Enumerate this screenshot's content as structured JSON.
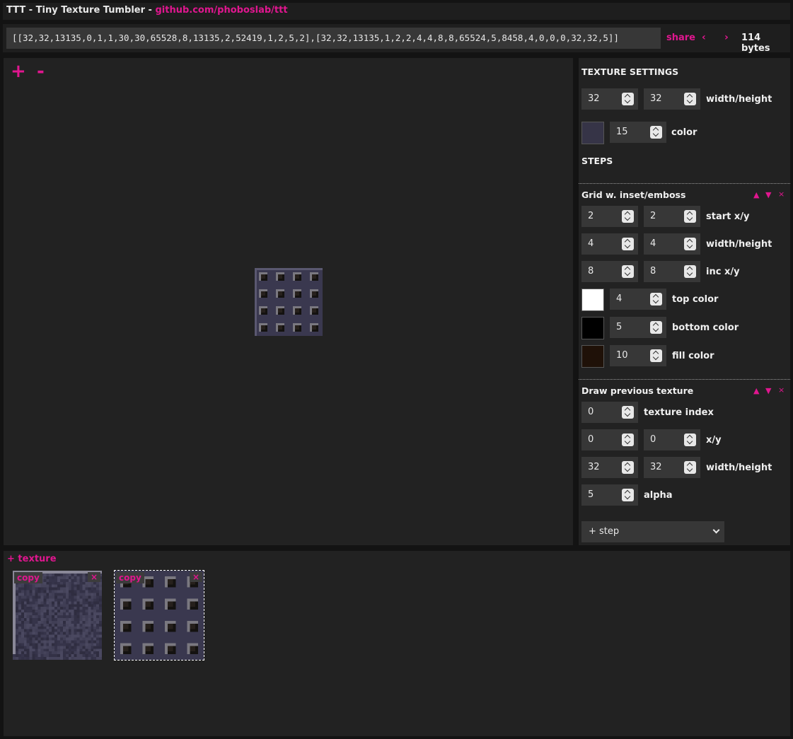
{
  "header": {
    "title": "TTT - Tiny Texture Tumbler - ",
    "link": "github.com/phoboslab/ttt"
  },
  "codebar": {
    "code": "[[32,32,13135,0,1,1,30,30,65528,8,13135,2,52419,1,2,5,2],[32,32,13135,1,2,2,4,4,8,8,65524,5,8458,4,0,0,0,32,32,5]]",
    "share": "share",
    "prev": "‹",
    "next": "›",
    "bytes": "114 bytes"
  },
  "canvas": {
    "zoom_in": "+",
    "zoom_out": "-"
  },
  "panel": {
    "texture_settings": {
      "title": "TEXTURE SETTINGS",
      "width": "32",
      "height": "32",
      "size_label": "width/height",
      "color_value": "15",
      "color_label": "color",
      "color_hex": "#363447"
    },
    "steps_title": "STEPS",
    "grid_step": {
      "title": "Grid w. inset/emboss",
      "start_x": "2",
      "start_y": "2",
      "start_label": "start x/y",
      "width": "4",
      "height": "4",
      "size_label": "width/height",
      "inc_x": "8",
      "inc_y": "8",
      "inc_label": "inc x/y",
      "top_color": "4",
      "top_label": "top color",
      "top_hex": "#ffffff",
      "bottom_color": "5",
      "bottom_label": "bottom color",
      "bottom_hex": "#000000",
      "fill_color": "10",
      "fill_label": "fill color",
      "fill_hex": "#1f1108"
    },
    "draw_step": {
      "title": "Draw previous texture",
      "index": "0",
      "index_label": "texture index",
      "x": "0",
      "y": "0",
      "xy_label": "x/y",
      "width": "32",
      "height": "32",
      "size_label": "width/height",
      "alpha": "5",
      "alpha_label": "alpha"
    },
    "step_controls": {
      "up": "▲",
      "down": "▼",
      "remove": "×"
    },
    "add_step": "+ step"
  },
  "textures": {
    "add": "+ texture",
    "items": [
      {
        "copy": "copy",
        "close": "×"
      },
      {
        "copy": "copy",
        "close": "×"
      }
    ]
  },
  "colors": {
    "accent": "#e0168f",
    "background": "#131313",
    "panel": "#222222",
    "input": "#373737"
  }
}
